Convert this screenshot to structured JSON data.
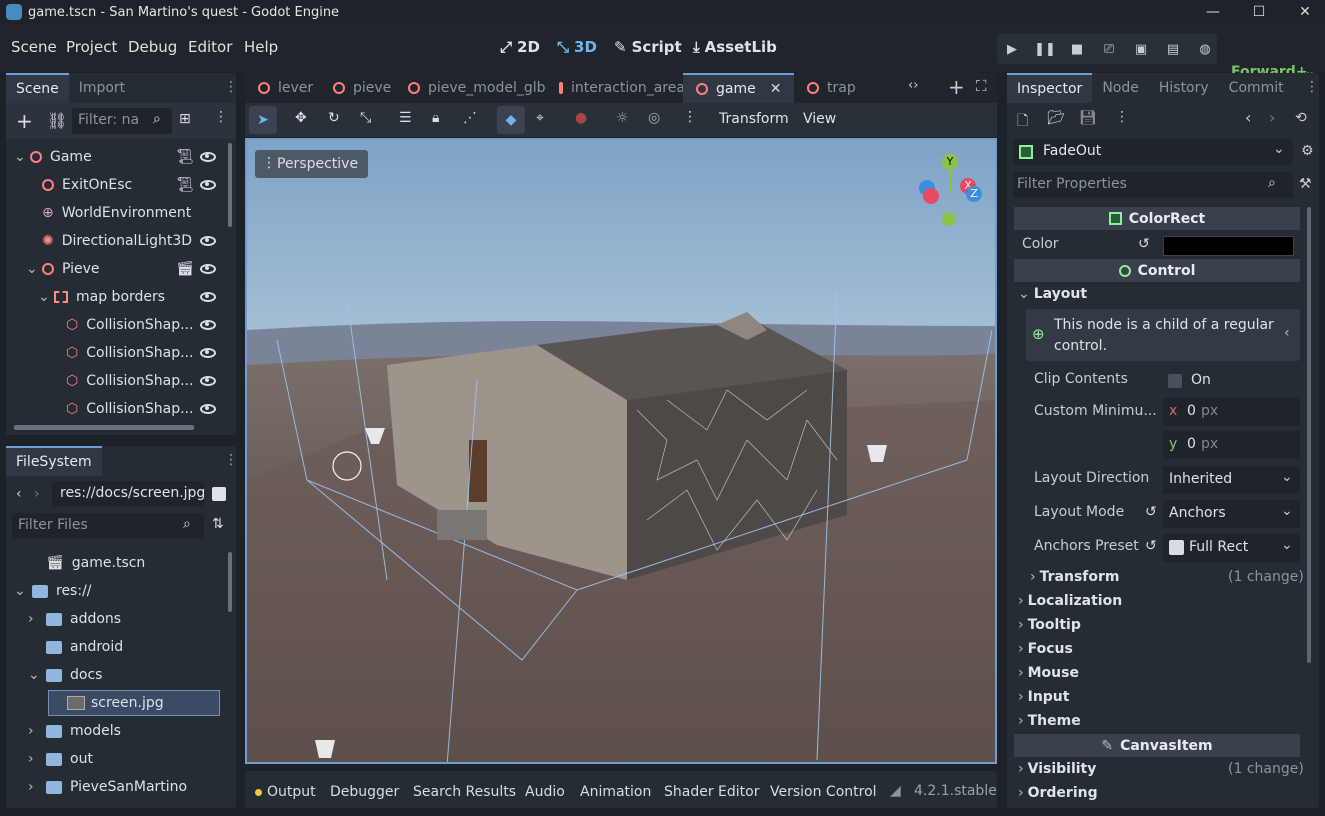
{
  "window": {
    "title": "game.tscn - San Martino's quest - Godot Engine",
    "minimize": "—",
    "maximize": "☐",
    "close": "✕"
  },
  "menubar": {
    "menus": [
      "Scene",
      "Project",
      "Debug",
      "Editor",
      "Help"
    ],
    "screens": [
      {
        "icon": "⤢",
        "label": "2D"
      },
      {
        "icon": "⤡",
        "label": "3D"
      },
      {
        "icon": "✎",
        "label": "Script"
      },
      {
        "icon": "⤓",
        "label": "AssetLib"
      }
    ],
    "renderer": "Forward+"
  },
  "scene_dock": {
    "tabs": [
      "Scene",
      "Import"
    ],
    "filter_placeholder": "Filter: na",
    "tree": [
      {
        "label": "Game",
        "depth": 0,
        "icon": "node",
        "expand": "⌄"
      },
      {
        "label": "ExitOnEsc",
        "depth": 1,
        "icon": "node"
      },
      {
        "label": "WorldEnvironment",
        "depth": 1,
        "icon": "globe"
      },
      {
        "label": "DirectionalLight3D",
        "depth": 1,
        "icon": "sun"
      },
      {
        "label": "Pieve",
        "depth": 1,
        "icon": "node",
        "expand": "⌄"
      },
      {
        "label": "map borders",
        "depth": 2,
        "icon": "area",
        "expand": "⌄"
      },
      {
        "label": "CollisionShap...",
        "depth": 3,
        "icon": "shape"
      },
      {
        "label": "CollisionShap...",
        "depth": 3,
        "icon": "shape"
      },
      {
        "label": "CollisionShap...",
        "depth": 3,
        "icon": "shape"
      },
      {
        "label": "CollisionShap...",
        "depth": 3,
        "icon": "shape"
      }
    ]
  },
  "filesystem_dock": {
    "title": "FileSystem",
    "path": "res://docs/screen.jpg",
    "filter_placeholder": "Filter Files",
    "items": [
      {
        "label": "game.tscn",
        "type": "scene"
      },
      {
        "label": "res://",
        "type": "folder",
        "expand": "⌄"
      },
      {
        "label": "addons",
        "type": "folder",
        "expand": "›"
      },
      {
        "label": "android",
        "type": "folder"
      },
      {
        "label": "docs",
        "type": "folder",
        "expand": "⌄"
      },
      {
        "label": "screen.jpg",
        "type": "image",
        "selected": true
      },
      {
        "label": "models",
        "type": "folder",
        "expand": "›"
      },
      {
        "label": "out",
        "type": "folder",
        "expand": "›"
      },
      {
        "label": "PieveSanMartino",
        "type": "folder",
        "expand": "›"
      }
    ]
  },
  "editor_tabs": [
    {
      "label": "lever"
    },
    {
      "label": "pieve"
    },
    {
      "label": "pieve_model_glb"
    },
    {
      "label": "interaction_area"
    },
    {
      "label": "game",
      "active": true
    },
    {
      "label": "trap"
    }
  ],
  "viewport_toolbar": {
    "transform": "Transform",
    "view": "View"
  },
  "viewport": {
    "perspective": "Perspective",
    "gizmo_axes": [
      "Y",
      "X",
      "Z"
    ]
  },
  "bottom_panel": {
    "tabs": [
      "Output",
      "Debugger",
      "Search Results",
      "Audio",
      "Animation",
      "Shader Editor",
      "Version Control"
    ],
    "version": "4.2.1.stable"
  },
  "inspector": {
    "tabs": [
      "Inspector",
      "Node",
      "History",
      "Commit"
    ],
    "node_name": "FadeOut",
    "filter_placeholder": "Filter Properties",
    "sections": {
      "colorrect": "ColorRect",
      "control": "Control",
      "canvasitem": "CanvasItem"
    },
    "color_label": "Color",
    "color_value": "#000000",
    "layout_label": "Layout",
    "layout_note": "This node is a child of a regular control.",
    "clip_contents": {
      "label": "Clip Contents",
      "value": "On"
    },
    "custom_min": {
      "label": "Custom Minimu...",
      "x": "0",
      "y": "0",
      "unit": "px"
    },
    "layout_direction": {
      "label": "Layout Direction",
      "value": "Inherited"
    },
    "layout_mode": {
      "label": "Layout Mode",
      "value": "Anchors"
    },
    "anchors_preset": {
      "label": "Anchors Preset",
      "value": "Full Rect"
    },
    "transform": {
      "label": "Transform",
      "note": "(1 change)"
    },
    "folds": [
      "Localization",
      "Tooltip",
      "Focus",
      "Mouse",
      "Input",
      "Theme"
    ],
    "visibility": {
      "label": "Visibility",
      "note": "(1 change)"
    },
    "ordering": "Ordering"
  }
}
